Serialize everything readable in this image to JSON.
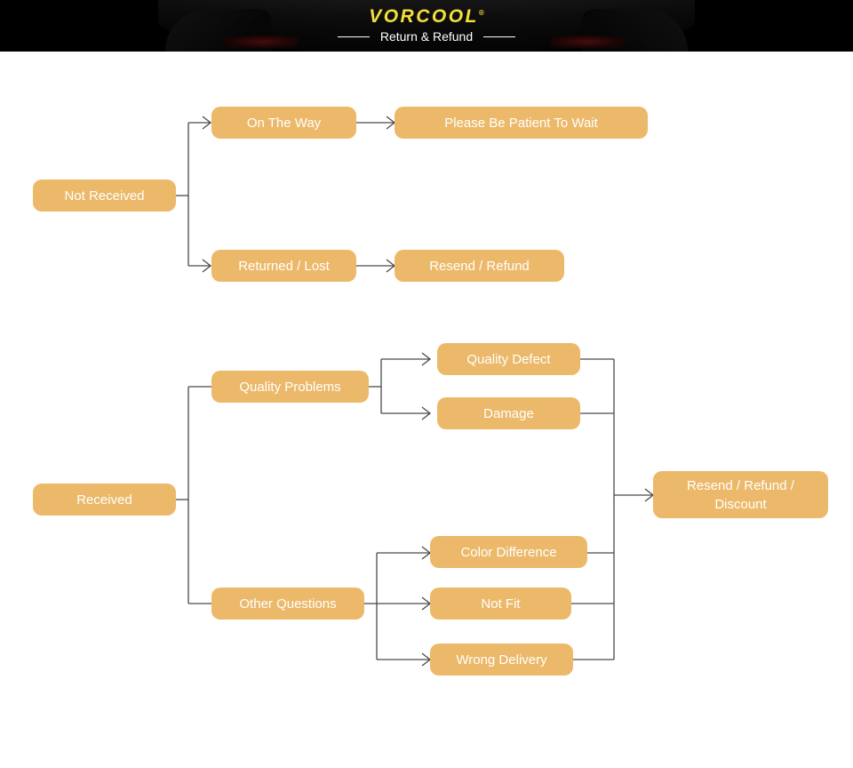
{
  "banner": {
    "logo_text": "VORCOOL",
    "logo_tm": "®",
    "subtitle": "Return & Refund",
    "background_color": "#000000",
    "logo_color": "#f5e03c",
    "subtitle_color": "#ffffff"
  },
  "chart_style": {
    "node_fill": "#ecb96a",
    "node_text_color": "#ffffff",
    "connector_color": "#4a4a4a",
    "page_background": "#ffffff"
  },
  "flow": {
    "branches": [
      {
        "id": "not-received",
        "root": {
          "label": "Not Received"
        },
        "paths": [
          {
            "step": {
              "label": "On The Way"
            },
            "outcome": {
              "label": "Please Be Patient To Wait"
            }
          },
          {
            "step": {
              "label": "Returned / Lost"
            },
            "outcome": {
              "label": "Resend / Refund"
            }
          }
        ]
      },
      {
        "id": "received",
        "root": {
          "label": "Received"
        },
        "categories": [
          {
            "label": "Quality Problems",
            "reasons": [
              {
                "label": "Quality Defect"
              },
              {
                "label": "Damage"
              }
            ]
          },
          {
            "label": "Other Questions",
            "reasons": [
              {
                "label": "Color Difference"
              },
              {
                "label": "Not Fit"
              },
              {
                "label": "Wrong Delivery"
              }
            ]
          }
        ],
        "outcome": {
          "label_line1": "Resend / Refund /",
          "label_line2": "Discount"
        }
      }
    ]
  }
}
